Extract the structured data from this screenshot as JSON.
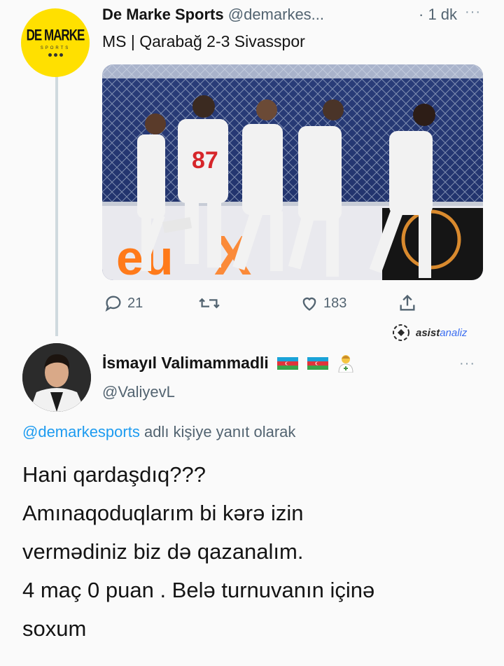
{
  "tweet": {
    "account_name": "De Marke Sports",
    "handle": "@demarkes...",
    "time": "· 1 dk",
    "more_label": "···",
    "text": "MS | Qarabağ 2-3 Sivasspor",
    "logo": {
      "main": "DE MARKE",
      "sub": "SPORTS"
    },
    "photo": {
      "shirt_number": "87"
    },
    "actions": {
      "replies": "21",
      "retweets": "",
      "likes": "183"
    }
  },
  "watermark": {
    "prefix": "asist",
    "suffix": "analiz"
  },
  "reply_tweet": {
    "name": "İsmayıl Valimammadli",
    "handle": "@ValiyevL",
    "more_label": "···",
    "reply_mention": "@demarkesports",
    "reply_context": " adlı kişiye yanıt olarak",
    "lines": [
      "Hani qardaşdıq???",
      "Amınaqoduqlarım bi kərə izin",
      "vermədiniz biz də qazanalım.",
      "4 maç 0 puan . Belə turnuvanın içinə",
      "soxum"
    ]
  },
  "colors": {
    "accent": "#1d9bf0",
    "secondary_text": "#536471",
    "logo_yellow": "#ffe000",
    "kit_white": "#f2f2f2",
    "kit_red": "#d6262a"
  }
}
